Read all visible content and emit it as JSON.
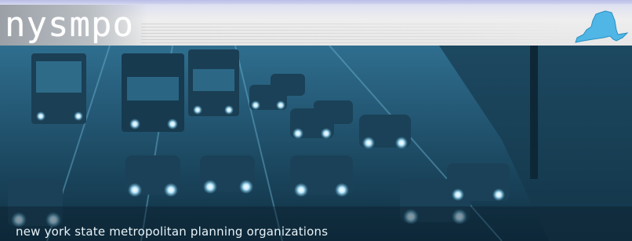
{
  "logo": {
    "text": "nysmpo",
    "state_icon": "new-york-state-icon"
  },
  "tagline": "new york state metropolitan planning organizations",
  "photo": {
    "subject": "highway-traffic-motion-blur"
  },
  "colors": {
    "header_bg": "#e8e8e8",
    "header_top": "#c8cce9",
    "logo_text": "#ffffff",
    "state_icon_fill": "#4fb6e6",
    "photo_tint": "#256383",
    "tagline_text": "#e9f3f8"
  }
}
